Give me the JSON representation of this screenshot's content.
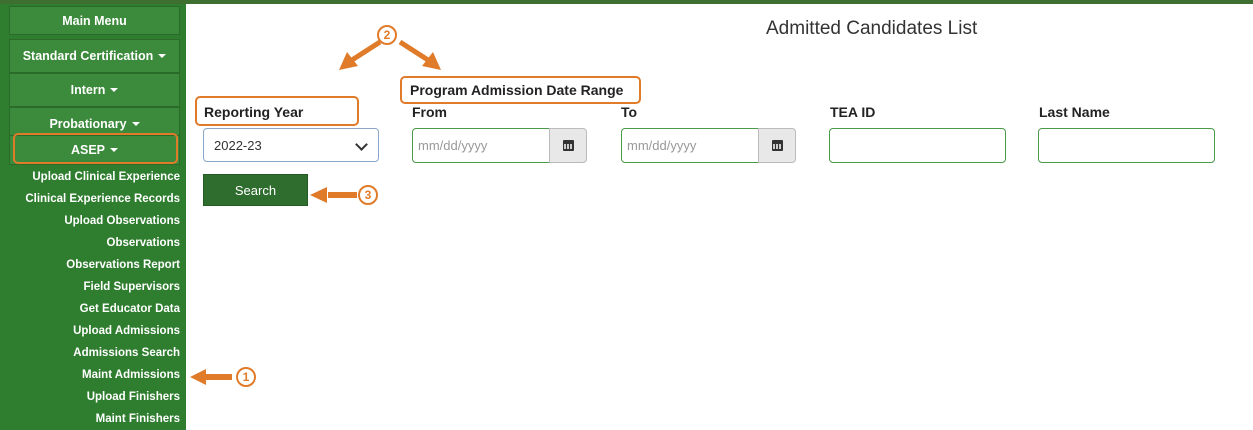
{
  "sidebar": {
    "main_menu": "Main Menu",
    "standard_certification": "Standard Certification",
    "intern": "Intern",
    "probationary": "Probationary",
    "asep": "ASEP",
    "items": [
      "Upload Clinical Experience",
      "Clinical Experience Records",
      "Upload Observations",
      "Observations",
      "Observations Report",
      "Field Supervisors",
      "Get Educator Data",
      "Upload Admissions",
      "Admissions Search",
      "Maint Admissions",
      "Upload Finishers",
      "Maint Finishers"
    ]
  },
  "main": {
    "title": "Admitted Candidates List",
    "reporting_year_label": "Reporting Year",
    "reporting_year_value": "2022-23",
    "date_range_label": "Program Admission Date Range",
    "from_label": "From",
    "to_label": "To",
    "from_placeholder": "mm/dd/yyyy",
    "to_placeholder": "mm/dd/yyyy",
    "tea_id_label": "TEA ID",
    "last_name_label": "Last Name",
    "search_label": "Search"
  },
  "annotations": {
    "one": "1",
    "two": "2",
    "three": "3",
    "color": "#e07b2a"
  }
}
